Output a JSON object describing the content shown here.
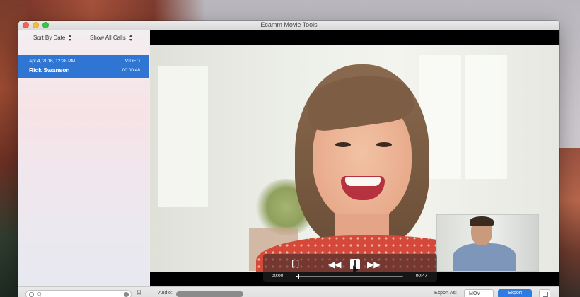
{
  "window": {
    "title": "Ecamm Movie Tools"
  },
  "sidebar": {
    "sort_label": "Sort By Date",
    "filter_label": "Show All Calls",
    "calls": [
      {
        "date": "Apr 4, 2016, 12:28 PM",
        "type": "VIDEO",
        "name": "Rick Swanson",
        "duration": "00:00:48",
        "selected": true
      }
    ]
  },
  "player": {
    "elapsed": "00:00",
    "remaining": "-00:47",
    "progress": 0.02,
    "state": "playing",
    "controls": {
      "trim_icon": "trim-brackets-icon",
      "rewind_icon": "rewind-icon",
      "pause_icon": "pause-icon",
      "forward_icon": "fast-forward-icon"
    }
  },
  "bottom_bar": {
    "search_placeholder": "Q",
    "audio_label": "Audio:",
    "export_as_label": "Export As:",
    "format_value": "MOV",
    "export_button": "Export",
    "share_icon": "share-icon"
  },
  "colors": {
    "selection": "#2f76d4",
    "accent": "#2f7be0"
  }
}
